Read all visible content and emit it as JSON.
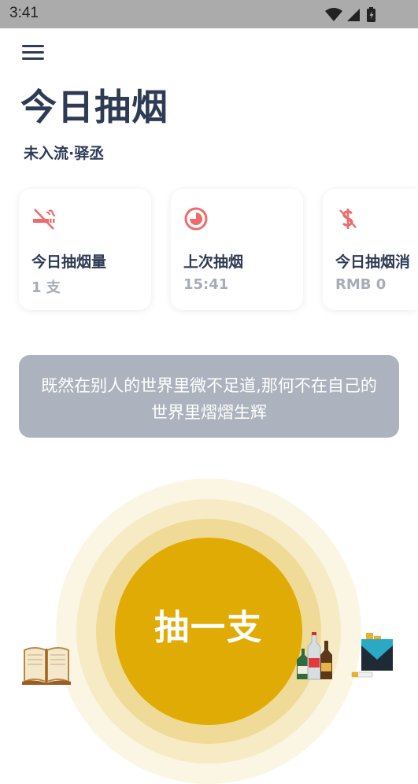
{
  "status_bar": {
    "time": "3:41"
  },
  "header": {
    "title": "今日抽烟",
    "subtitle": "未入流·驿丞"
  },
  "cards": [
    {
      "label": "今日抽烟量",
      "value": "1 支",
      "icon": "no-smoking-icon"
    },
    {
      "label": "上次抽烟",
      "value": "15:41",
      "icon": "clock-icon"
    },
    {
      "label": "今日抽烟消",
      "value": "RMB 0",
      "icon": "dollar-icon"
    }
  ],
  "quote": {
    "text": "既然在别人的世界里微不足道,那何不在自己的世界里熠熠生辉"
  },
  "smoke_button": {
    "label": "抽一支"
  },
  "side_icons": [
    "book-icon",
    "bottles-icon",
    "cigarette-pack-icon"
  ],
  "colors": {
    "accent": "#e0ab05",
    "title_text": "#2f3b55",
    "card_icon": "#ef6b6b",
    "quote_bg": "#acb3be"
  }
}
